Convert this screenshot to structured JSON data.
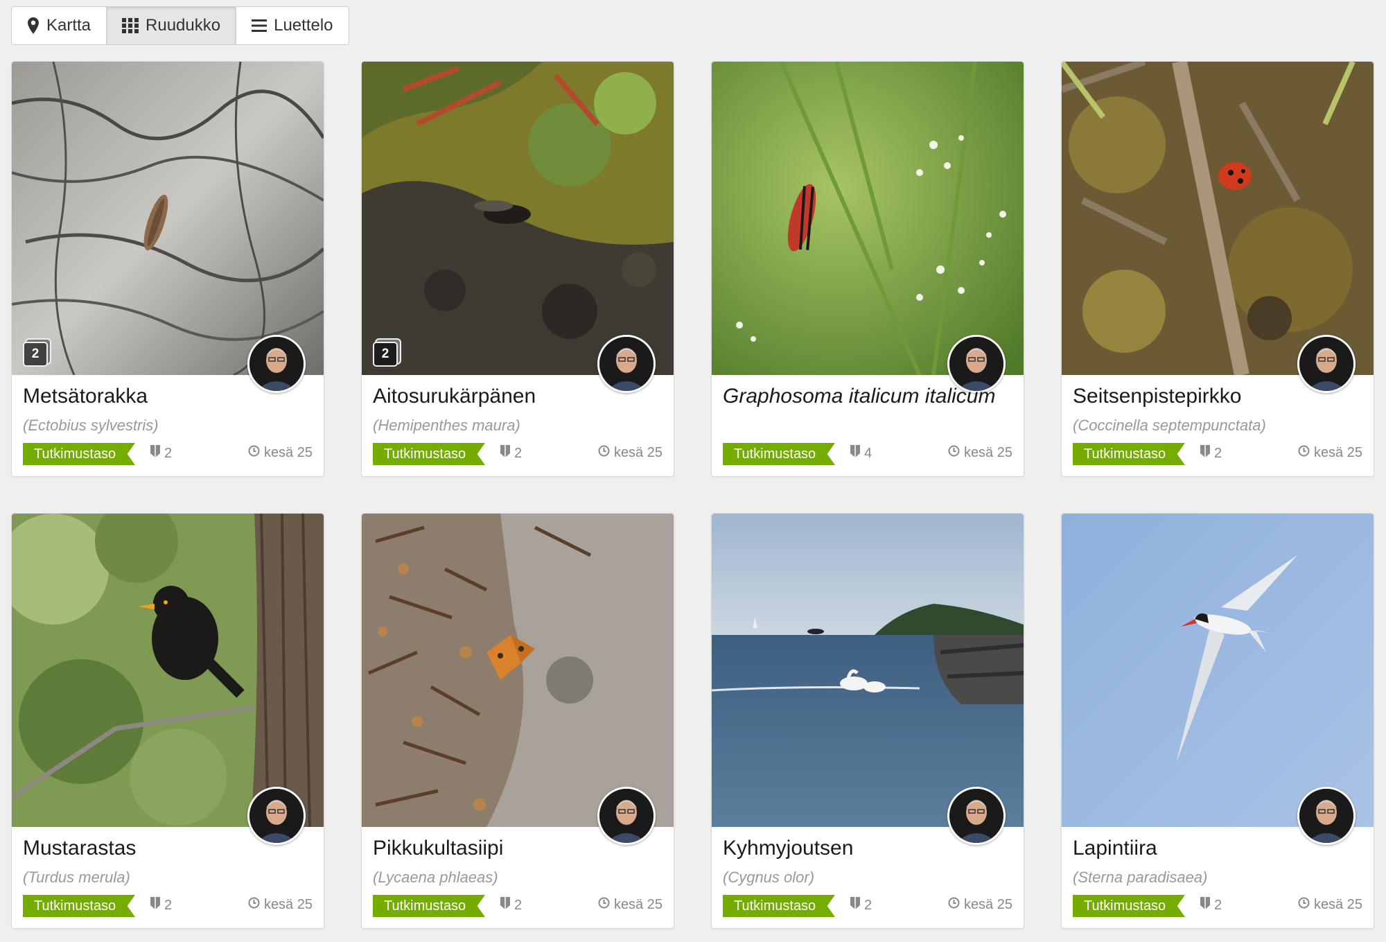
{
  "view_toggle": {
    "map": {
      "label": "Kartta",
      "icon": "map-marker-icon"
    },
    "grid": {
      "label": "Ruudukko",
      "icon": "grid-icon"
    },
    "list": {
      "label": "Luettelo",
      "icon": "list-icon"
    },
    "active": "grid"
  },
  "colors": {
    "quality": "#74ac00",
    "background": "#efefef"
  },
  "observations": [
    {
      "common_name": "Metsätorakka",
      "scientific_name": "(Ectobius sylvestris)",
      "quality": "Tutkimustaso",
      "identifications": "2",
      "date": "kesä 25",
      "photo_count": "2",
      "photo_subject": "insect on bark"
    },
    {
      "common_name": "Aitosurukärpänen",
      "scientific_name": "(Hemipenthes maura)",
      "quality": "Tutkimustaso",
      "identifications": "2",
      "date": "kesä 25",
      "photo_count": "2",
      "photo_subject": "fly on moss"
    },
    {
      "common_name": "Graphosoma italicum italicum",
      "scientific_name": "",
      "quality": "Tutkimustaso",
      "identifications": "4",
      "date": "kesä 25",
      "photo_count": "",
      "photo_subject": "striped bugs on umbel"
    },
    {
      "common_name": "Seitsenpistepirkko",
      "scientific_name": "(Coccinella septempunctata)",
      "quality": "Tutkimustaso",
      "identifications": "2",
      "date": "kesä 25",
      "photo_count": "",
      "photo_subject": "ladybird on moss"
    },
    {
      "common_name": "Mustarastas",
      "scientific_name": "(Turdus merula)",
      "quality": "Tutkimustaso",
      "identifications": "2",
      "date": "kesä 25",
      "photo_count": "",
      "photo_subject": "blackbird on branch"
    },
    {
      "common_name": "Pikkukultasiipi",
      "scientific_name": "(Lycaena phlaeas)",
      "quality": "Tutkimustaso",
      "identifications": "2",
      "date": "kesä 25",
      "photo_count": "",
      "photo_subject": "butterfly on ground"
    },
    {
      "common_name": "Kyhmyjoutsen",
      "scientific_name": "(Cygnus olor)",
      "quality": "Tutkimustaso",
      "identifications": "2",
      "date": "kesä 25",
      "photo_count": "",
      "photo_subject": "swans on sea"
    },
    {
      "common_name": "Lapintiira",
      "scientific_name": "(Sterna paradisaea)",
      "quality": "Tutkimustaso",
      "identifications": "2",
      "date": "kesä 25",
      "photo_count": "",
      "photo_subject": "tern in sky"
    }
  ]
}
